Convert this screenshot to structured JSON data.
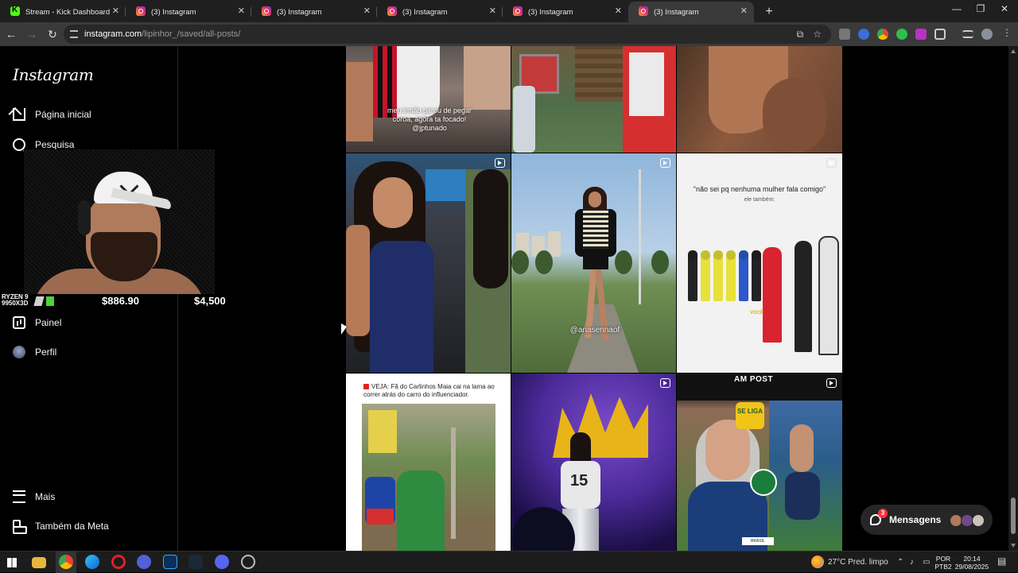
{
  "browser": {
    "tabs": [
      {
        "title": "Stream - Kick Dashboard",
        "favicon": "kick-icon",
        "active": false
      },
      {
        "title": "(3) Instagram",
        "favicon": "instagram-icon",
        "active": false
      },
      {
        "title": "(3) Instagram",
        "favicon": "instagram-icon",
        "active": false
      },
      {
        "title": "(3) Instagram",
        "favicon": "instagram-icon",
        "active": false
      },
      {
        "title": "(3) Instagram",
        "favicon": "instagram-icon",
        "active": false
      },
      {
        "title": "(3) Instagram",
        "favicon": "instagram-icon",
        "active": true
      }
    ],
    "new_tab": "+",
    "window_controls": {
      "minimize": "—",
      "maximize": "❐",
      "close": "✕"
    },
    "nav": {
      "back": "←",
      "forward": "→",
      "reload": "↻"
    },
    "url_host": "instagram.com",
    "url_path": "/lipinhor_/saved/all-posts/"
  },
  "sidebar": {
    "logo": "Instagram",
    "items": [
      {
        "label": "Página inicial",
        "icon": "home-icon"
      },
      {
        "label": "Pesquisa",
        "icon": "search-icon"
      },
      {
        "label": "Painel",
        "icon": "dashboard-icon"
      },
      {
        "label": "Perfil",
        "icon": "profile-avatar"
      },
      {
        "label": "Mais",
        "icon": "menu-icon"
      },
      {
        "label": "Também da Meta",
        "icon": "meta-icon"
      }
    ]
  },
  "stream_overlay": {
    "cpu_label": "RYZEN 9 9950X3D",
    "price_1": "$886.90",
    "price_2": "$4,500"
  },
  "posts": {
    "p1_caption": "meu irmão parou de pegar coroa, agora ta focado! @jptunado",
    "p5_watermark": "@anasennaof",
    "p6_title": "\"não sei pq nenhuma mulher fala comigo\"",
    "p6_subtitle": "ele também:",
    "p6_label": "VOCÊ",
    "p7_headline": "VEJA: Fã do Carlinhos Maia cai na lama ao correr atrás do carro do influenciador.",
    "p9_brand": "AM POST",
    "p9_badge": "SE LIGA",
    "p9_tag": "BRASIL"
  },
  "messages": {
    "label": "Mensagens",
    "badge": "3"
  },
  "taskbar": {
    "weather": "27°C  Pred. limpo",
    "lang_1": "POR",
    "lang_2": "PTB2",
    "time": "20:14",
    "date": "29/08/2025"
  },
  "colors": {
    "instagram_gradient_start": "#f9a12e",
    "instagram_gradient_end": "#8a3ab9",
    "kick_green": "#53fc18",
    "badge_red": "#ff3040"
  }
}
